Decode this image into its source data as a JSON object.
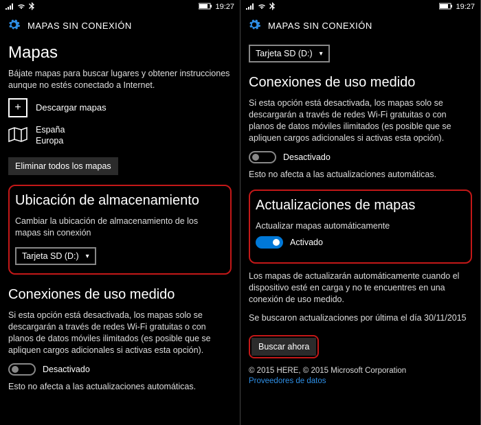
{
  "statusbar": {
    "time": "19:27"
  },
  "header": {
    "title": "MAPAS SIN CONEXIÓN"
  },
  "left": {
    "h1": "Mapas",
    "intro": "Bájate mapas para buscar lugares y obtener instrucciones aunque no estés conectado a Internet.",
    "download_label": "Descargar mapas",
    "region1": "España",
    "region2": "Europa",
    "delete_all": "Eliminar todos los mapas",
    "storage_h": "Ubicación de almacenamiento",
    "storage_desc": "Cambiar la ubicación de almacenamiento de los mapas sin conexión",
    "storage_select": "Tarjeta SD (D:)",
    "metered_h": "Conexiones de uso medido",
    "metered_desc": "Si esta opción está desactivada, los mapas solo se descargarán a través de redes Wi-Fi gratuitas o con planos de datos móviles ilimitados (es posible que se apliquen cargos adicionales si activas esta opción).",
    "metered_state": "Desactivado",
    "metered_note": "Esto no afecta a las actualizaciones automáticas."
  },
  "right": {
    "storage_select": "Tarjeta SD (D:)",
    "metered_h": "Conexiones de uso medido",
    "metered_desc": "Si esta opción está desactivada, los mapas solo se descargarán a través de redes Wi-Fi gratuitas o con planos de datos móviles ilimitados (es posible que se apliquen cargos adicionales si activas esta opción).",
    "metered_state": "Desactivado",
    "metered_note": "Esto no afecta a las actualizaciones automáticas.",
    "updates_h": "Actualizaciones de mapas",
    "updates_sub": "Actualizar mapas automáticamente",
    "updates_state": "Activado",
    "updates_desc": "Los mapas de actualizarán automáticamente cuando el dispositivo esté en carga y no te encuentres en una conexión de uso medido.",
    "last_check": "Se buscaron actualizaciones por última el día 30/11/2015",
    "check_now": "Buscar ahora",
    "copyright": "© 2015 HERE, © 2015 Microsoft Corporation",
    "providers": "Proveedores de datos"
  }
}
